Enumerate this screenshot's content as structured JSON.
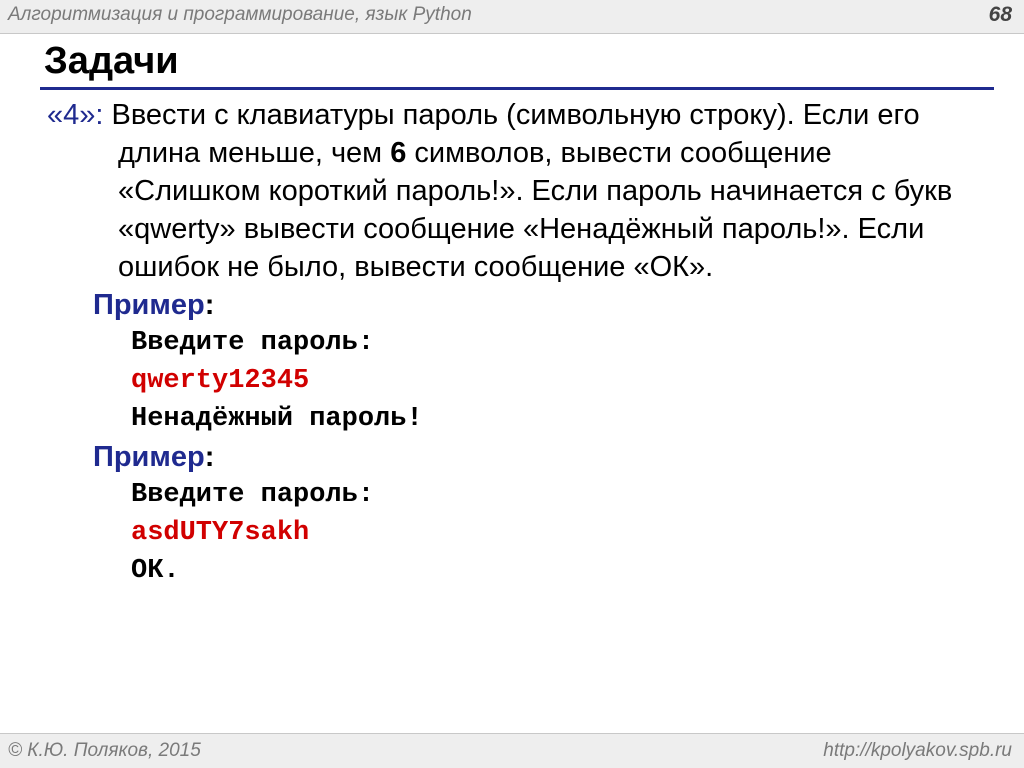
{
  "header": {
    "course": "Алгоритмизация и программирование, язык Python",
    "slide_number": "68"
  },
  "title": "Задачи",
  "task": {
    "label": "«4»:",
    "text_before": " Ввести с клавиатуры пароль (символьную строку). Если его длина меньше, чем ",
    "number": "6",
    "text_after": " символов, вывести сообщение «Слишком короткий пароль!». Если пароль начинается с букв «qwerty» вывести сообщение «Ненадёжный пароль!». Если ошибок не было, вывести сообщение «ОК»."
  },
  "examples": [
    {
      "label": "Пример",
      "colon": ":",
      "prompt": "Введите пароль:",
      "input": "qwerty12345",
      "output": "Ненадёжный пароль!"
    },
    {
      "label": "Пример",
      "colon": ":",
      "prompt": "Введите пароль:",
      "input": "asdUTY7sakh",
      "output": "ОК."
    }
  ],
  "footer": {
    "author": "© К.Ю. Поляков, 2015",
    "url": "http://kpolyakov.spb.ru"
  },
  "colors": {
    "accent": "#1f2a8f",
    "input_text": "#d10000",
    "header_bg": "#eeeeee"
  }
}
